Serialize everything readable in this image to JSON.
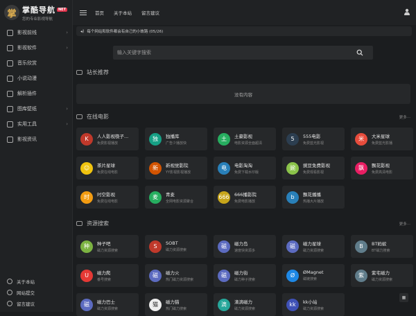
{
  "brand": {
    "mark": "掌",
    "title": "掌酷导航",
    "badge": "NET",
    "subtitle": "您的专业影视导航"
  },
  "sidebar": {
    "items": [
      {
        "label": "影视前线",
        "icon": "film-icon"
      },
      {
        "label": "影视软件",
        "icon": "apps-icon"
      },
      {
        "label": "音乐欣赏",
        "icon": "music-icon"
      },
      {
        "label": "小说动漫",
        "icon": "book-icon"
      },
      {
        "label": "解析插件",
        "icon": "plugin-icon"
      },
      {
        "label": "图库壁纸",
        "icon": "image-icon"
      },
      {
        "label": "实用工具",
        "icon": "tool-icon"
      },
      {
        "label": "影视资讯",
        "icon": "news-icon"
      }
    ],
    "footer": [
      {
        "label": "关于本站",
        "icon": "info-icon"
      },
      {
        "label": "网站提交",
        "icon": "submit-icon"
      },
      {
        "label": "留言建议",
        "icon": "message-icon"
      }
    ]
  },
  "header": {
    "links": [
      "首页",
      "关于本站",
      "留言建议"
    ]
  },
  "notice": {
    "text": "每个网站和软件都会有自己的小故路 (05/26)"
  },
  "search": {
    "placeholder": "输入关键字搜索"
  },
  "sections": {
    "recommend": {
      "title": "站长推荐",
      "empty": "没有内容"
    },
    "online": {
      "title": "在线电影",
      "more": "更多",
      "cards": [
        {
          "name": "人人影视筷子...",
          "desc": "免费影视播放",
          "icon": "K",
          "color": "#c0392b"
        },
        {
          "name": "独播库",
          "desc": "广告少播放快",
          "icon": "独",
          "color": "#16a085"
        },
        {
          "name": "土豪影视",
          "desc": "电影资源全面超清",
          "icon": "土",
          "color": "#27ae60"
        },
        {
          "name": "555电影",
          "desc": "免费蓝光影视",
          "icon": "5",
          "color": "#2c3e50"
        },
        {
          "name": "大米星球",
          "desc": "免费蓝光影播",
          "icon": "米",
          "color": "#e74c3c"
        },
        {
          "name": "茶片星球",
          "desc": "免费在线电影",
          "icon": "☺",
          "color": "#f1c40f"
        },
        {
          "name": "新视觉影院",
          "desc": "YY影视影视播放",
          "icon": "新",
          "color": "#d35400"
        },
        {
          "name": "电影淘淘",
          "desc": "免费下载水印版",
          "icon": "电",
          "color": "#2980b9"
        },
        {
          "name": "豌豆免费影视",
          "desc": "免费观看影视",
          "icon": "豌",
          "color": "#8bc34a"
        },
        {
          "name": "飘花影视",
          "desc": "免费高清电影",
          "icon": "飘",
          "color": "#e91e63"
        },
        {
          "name": "时空影视",
          "desc": "免费在线电影",
          "icon": "时",
          "color": "#f39c12"
        },
        {
          "name": "青麦",
          "desc": "全网电影资源聚合",
          "icon": "麦",
          "color": "#27ae60"
        },
        {
          "name": "666播影院",
          "desc": "免费电影播放",
          "icon": "666",
          "color": "#c7a51a"
        },
        {
          "name": "飘花播播",
          "desc": "热播大片播放",
          "icon": "b",
          "color": "#2980b9"
        }
      ]
    },
    "resource": {
      "title": "资源搜索",
      "more": "更多",
      "cards": [
        {
          "name": "种子吧",
          "desc": "磁力资源搜索",
          "icon": "种",
          "color": "#7cb342"
        },
        {
          "name": "SOBT",
          "desc": "磁力资源搜索",
          "icon": "S",
          "color": "#c0392b"
        },
        {
          "name": "磁力岛",
          "desc": "速度快资源多",
          "icon": "磁",
          "color": "#5c6bc0"
        },
        {
          "name": "磁力星球",
          "desc": "磁力资源搜索",
          "icon": "磁",
          "color": "#5c6bc0"
        },
        {
          "name": "BT蚂蚁",
          "desc": "BT磁力搜索",
          "icon": "B",
          "color": "#607d8b"
        },
        {
          "name": "磁力爬",
          "desc": "番号搜索",
          "icon": "U",
          "color": "#e53935"
        },
        {
          "name": "磁力火",
          "desc": "热门磁力资源搜索",
          "icon": "磁",
          "color": "#5c6bc0"
        },
        {
          "name": "磁力街",
          "desc": "磁力种子搜索",
          "icon": "磁",
          "color": "#5c6bc0"
        },
        {
          "name": "ØMagnet",
          "desc": "磁链搜索",
          "icon": "Ø",
          "color": "#1e88e5"
        },
        {
          "name": "紫宅磁力",
          "desc": "磁力资源搜索",
          "icon": "紫",
          "color": "#607d8b"
        },
        {
          "name": "磁力巴士",
          "desc": "磁力资源搜索",
          "icon": "磁",
          "color": "#5c6bc0"
        },
        {
          "name": "磁力猫",
          "desc": "热门磁力搜索",
          "icon": "猫",
          "color": "#eeeeee"
        },
        {
          "name": "滴滴磁力",
          "desc": "磁力资源搜索",
          "icon": "滴",
          "color": "#26a69a"
        },
        {
          "name": "kk小站",
          "desc": "磁力资源搜索",
          "icon": "kk",
          "color": "#3f51b5"
        }
      ]
    }
  }
}
